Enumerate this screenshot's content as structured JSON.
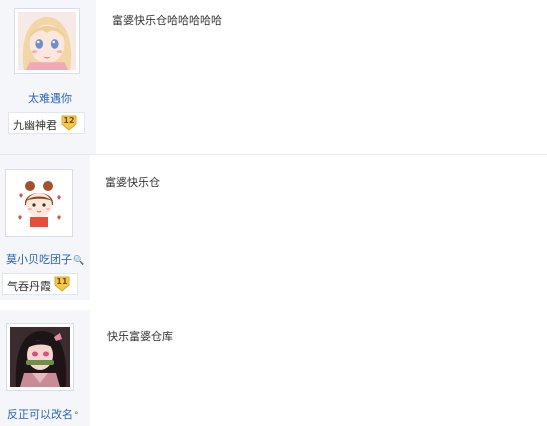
{
  "colors": {
    "username_link": "#2d64b3",
    "sidebar_bg": "#f4f6fa",
    "level_badge": "#f2c94c"
  },
  "posts": [
    {
      "author": "太难遇你",
      "author_mark": "",
      "avatar_icon": "anime-girl-avatar",
      "badge_name": "九幽神君",
      "badge_level": "12",
      "content": "富婆快乐仓哈哈哈哈哈"
    },
    {
      "author": "莫小贝吃团子",
      "author_mark": "🔍",
      "avatar_icon": "chibi-girl-avatar",
      "badge_name": "气吞丹霞",
      "badge_level": "11",
      "content": "富婆快乐仓"
    },
    {
      "author": "反正可以改名",
      "author_mark": "°",
      "avatar_icon": "dark-hair-girl-avatar",
      "badge_name": "",
      "badge_level": "",
      "content": "快乐富婆仓库"
    }
  ]
}
